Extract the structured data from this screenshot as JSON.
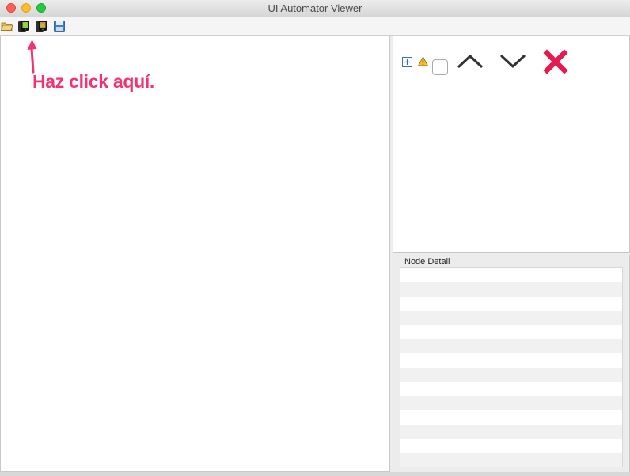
{
  "window": {
    "title": "UI Automator Viewer"
  },
  "toolbar": {
    "buttons": [
      {
        "icon": "folder-open-icon"
      },
      {
        "icon": "device-screenshot-icon"
      },
      {
        "icon": "device-screenshot-compressed-icon"
      },
      {
        "icon": "save-icon"
      }
    ]
  },
  "annotation": {
    "text": "Haz click aquí.",
    "color": "#f2336f"
  },
  "tree_controls": {
    "expand": "expand-all-icon",
    "warning": "warning-icon",
    "up": "chevron-up-icon",
    "down": "chevron-down-icon",
    "clear": "clear-icon",
    "clear_color": "#e8194f"
  },
  "node_detail": {
    "title": "Node Detail",
    "rows": 14
  }
}
